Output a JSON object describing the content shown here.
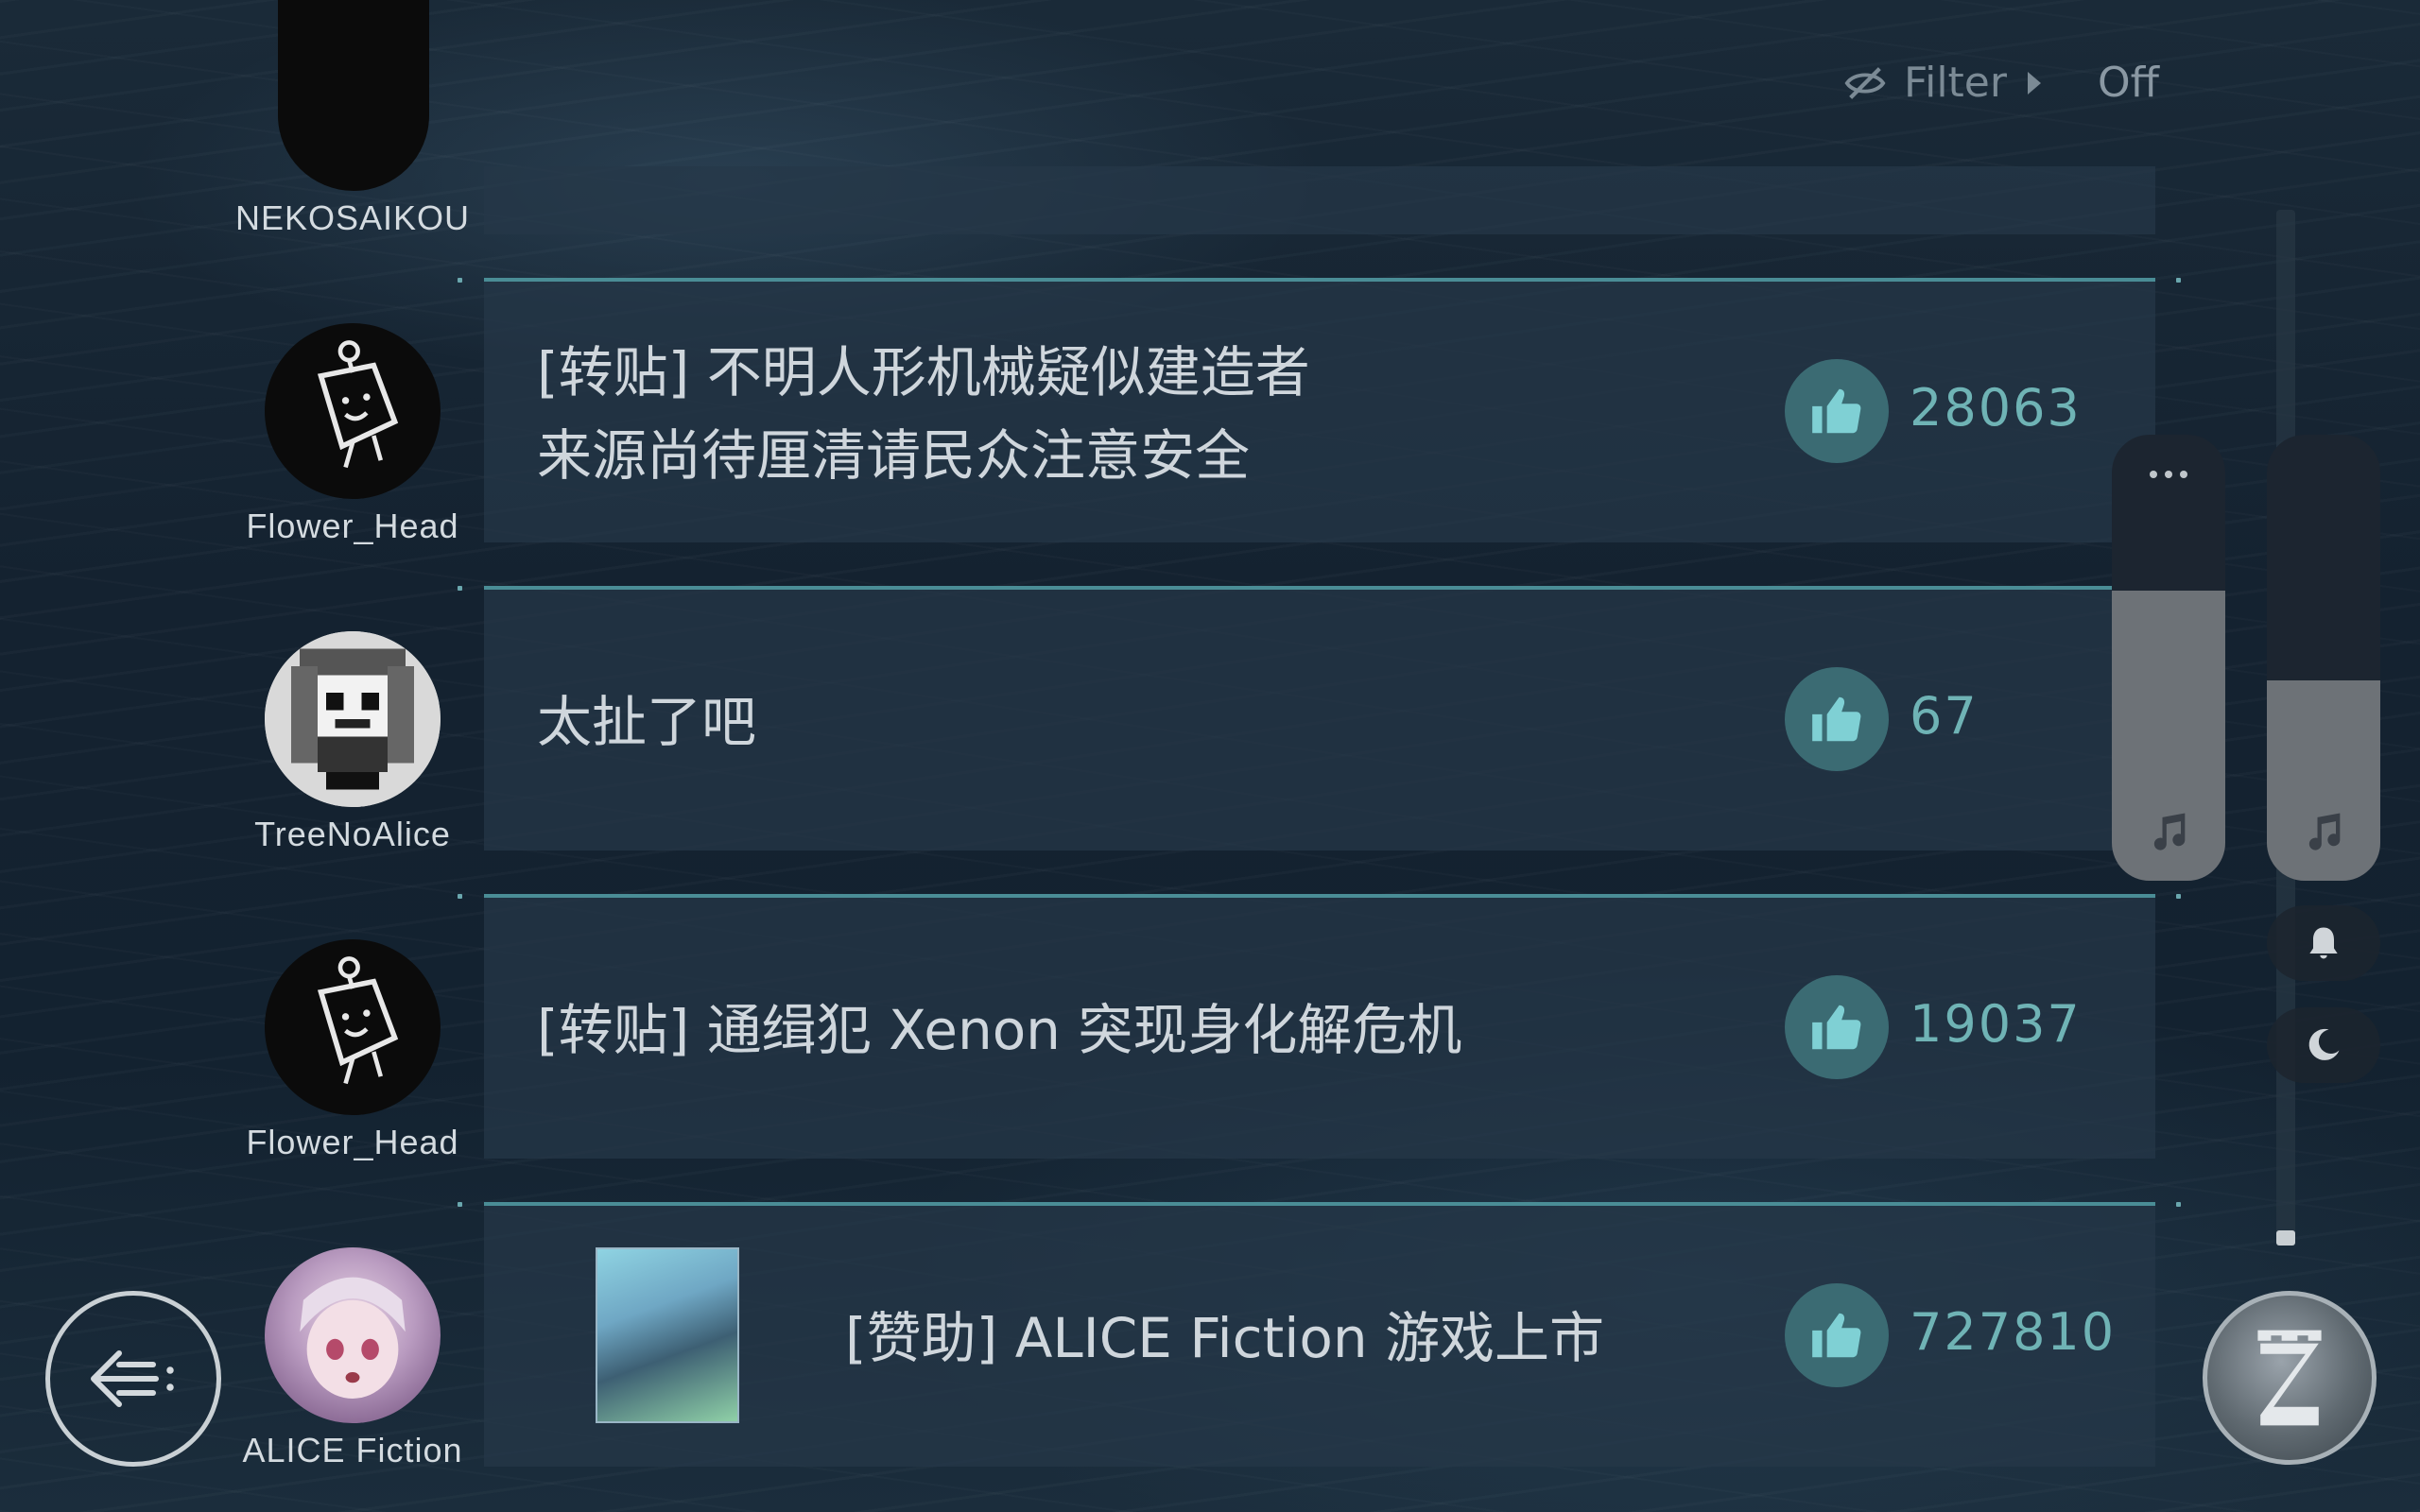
{
  "filter": {
    "label": "Filter",
    "state": "Off"
  },
  "posts": [
    {
      "user": "NEKOSAIKOU",
      "text": [],
      "likes": ""
    },
    {
      "user": "Flower_Head",
      "text": [
        "[转贴] 不明人形机械疑似建造者",
        "来源尚待厘清请民众注意安全"
      ],
      "likes": "28063"
    },
    {
      "user": "TreeNoAlice",
      "text": [
        "太扯了吧"
      ],
      "likes": "67"
    },
    {
      "user": "Flower_Head",
      "text": [
        "[转贴] 通缉犯 Xenon 突现身化解危机"
      ],
      "likes": "19037"
    },
    {
      "user": "ALICE Fiction",
      "text": [
        "[赞助] ALICE Fiction 游戏上市"
      ],
      "likes": "727810"
    }
  ],
  "volume": {
    "music_level": 0.65,
    "effects_level": 0.45
  },
  "colors": {
    "accent": "#4a8d96",
    "like": "#6fb3b5"
  }
}
